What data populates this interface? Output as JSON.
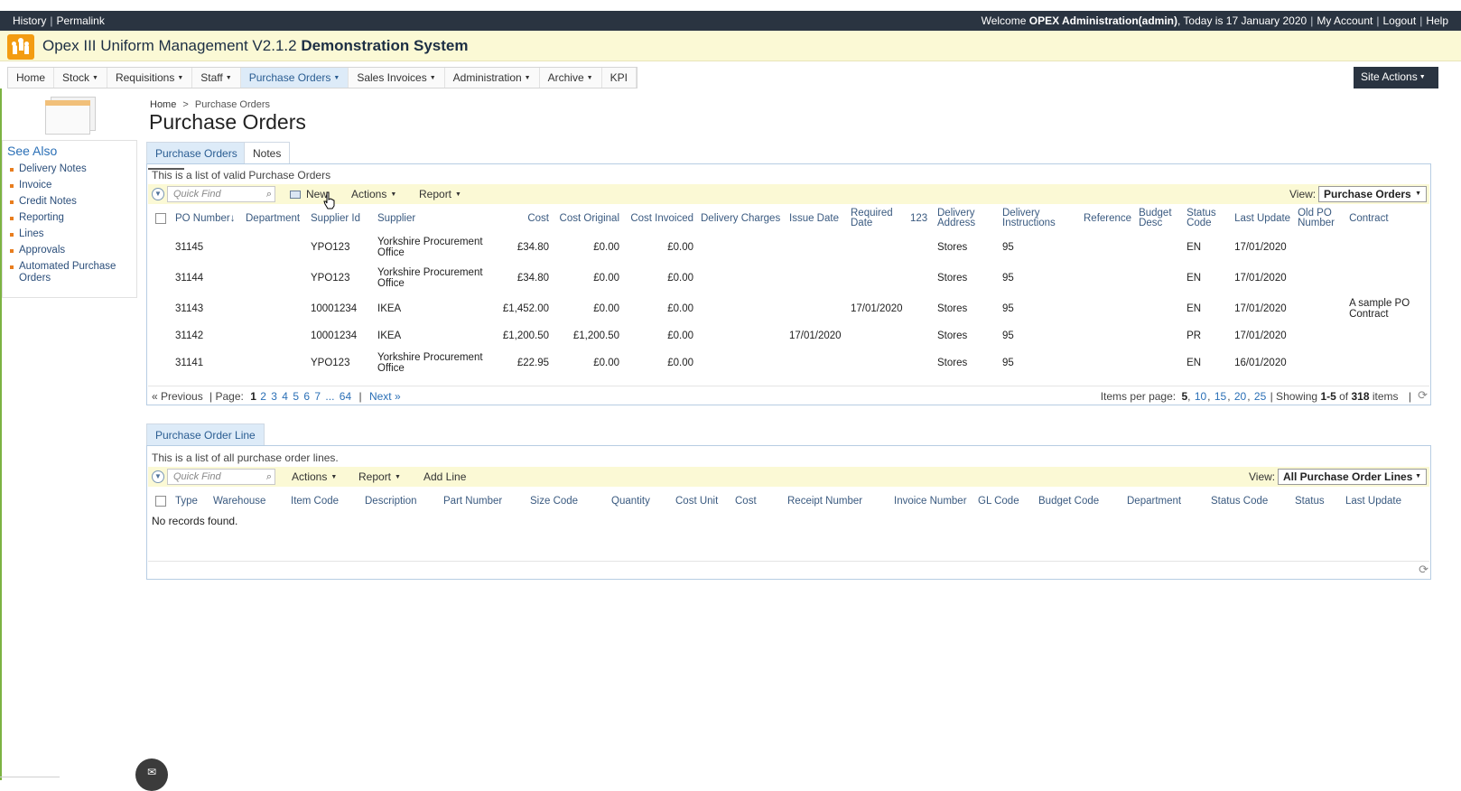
{
  "topbar": {
    "history": "History",
    "permalink": "Permalink",
    "welcome_prefix": "Welcome ",
    "user": "OPEX Administration(admin)",
    "today": ", Today is 17 January 2020",
    "my_account": "My Account",
    "logout": "Logout",
    "help": "Help"
  },
  "app": {
    "title_main": "Opex III Uniform Management V2.1.2 ",
    "title_bold": "Demonstration System",
    "accent": "#f39c12"
  },
  "nav": {
    "items": [
      {
        "label": "Home"
      },
      {
        "label": "Stock"
      },
      {
        "label": "Requisitions"
      },
      {
        "label": "Staff"
      },
      {
        "label": "Purchase Orders"
      },
      {
        "label": "Sales Invoices"
      },
      {
        "label": "Administration"
      },
      {
        "label": "Archive"
      },
      {
        "label": "KPI"
      }
    ],
    "site_actions": "Site Actions"
  },
  "sidebar": {
    "see_also": "See Also",
    "links": [
      "Delivery Notes",
      "Invoice",
      "Credit Notes",
      "Reporting",
      "Lines",
      "Approvals",
      "Automated Purchase Orders"
    ]
  },
  "breadcrumb": {
    "home": "Home",
    "sep": ">",
    "current": "Purchase Orders"
  },
  "page_title": "Purchase Orders",
  "tabs": {
    "purchase_orders": "Purchase Orders",
    "notes": "Notes",
    "purchase_order_line": "Purchase Order Line"
  },
  "po_panel": {
    "description": "This is a list of valid Purchase Orders",
    "quick_find": "Quick Find",
    "new": "New",
    "actions": "Actions",
    "report": "Report",
    "view_label": "View:",
    "view_value": "Purchase Orders",
    "columns": [
      "PO Number↓",
      "Department",
      "Supplier Id",
      "Supplier",
      "Cost",
      "Cost Original",
      "Cost Invoiced",
      "Delivery Charges",
      "Issue Date",
      "Required Date",
      "123",
      "Delivery Address",
      "Delivery Instructions",
      "Reference",
      "Budget Desc",
      "Status Code",
      "Last Update",
      "Old PO Number",
      "Contract"
    ],
    "rows": [
      {
        "po": "31145",
        "dept": "",
        "supplier_id": "YPO123",
        "supplier": "Yorkshire Procurement Office",
        "cost": "£34.80",
        "cost_original": "£0.00",
        "cost_invoiced": "£0.00",
        "delivery_charges": "",
        "issue_date": "",
        "required_date": "",
        "c123": "",
        "delivery_address": "Stores",
        "delivery_instructions": "95",
        "reference": "",
        "budget_desc": "",
        "status_code": "EN",
        "last_update": "17/01/2020",
        "old_po": "",
        "contract": ""
      },
      {
        "po": "31144",
        "dept": "",
        "supplier_id": "YPO123",
        "supplier": "Yorkshire Procurement Office",
        "cost": "£34.80",
        "cost_original": "£0.00",
        "cost_invoiced": "£0.00",
        "delivery_charges": "",
        "issue_date": "",
        "required_date": "",
        "c123": "",
        "delivery_address": "Stores",
        "delivery_instructions": "95",
        "reference": "",
        "budget_desc": "",
        "status_code": "EN",
        "last_update": "17/01/2020",
        "old_po": "",
        "contract": ""
      },
      {
        "po": "31143",
        "dept": "",
        "supplier_id": "10001234",
        "supplier": "IKEA",
        "cost": "£1,452.00",
        "cost_original": "£0.00",
        "cost_invoiced": "£0.00",
        "delivery_charges": "",
        "issue_date": "",
        "required_date": "17/01/2020",
        "c123": "",
        "delivery_address": "Stores",
        "delivery_instructions": "95",
        "reference": "",
        "budget_desc": "",
        "status_code": "EN",
        "last_update": "17/01/2020",
        "old_po": "",
        "contract": "A sample PO Contract"
      },
      {
        "po": "31142",
        "dept": "",
        "supplier_id": "10001234",
        "supplier": "IKEA",
        "cost": "£1,200.50",
        "cost_original": "£1,200.50",
        "cost_invoiced": "£0.00",
        "delivery_charges": "",
        "issue_date": "17/01/2020",
        "required_date": "",
        "c123": "",
        "delivery_address": "Stores",
        "delivery_instructions": "95",
        "reference": "",
        "budget_desc": "",
        "status_code": "PR",
        "last_update": "17/01/2020",
        "old_po": "",
        "contract": ""
      },
      {
        "po": "31141",
        "dept": "",
        "supplier_id": "YPO123",
        "supplier": "Yorkshire Procurement Office",
        "cost": "£22.95",
        "cost_original": "£0.00",
        "cost_invoiced": "£0.00",
        "delivery_charges": "",
        "issue_date": "",
        "required_date": "",
        "c123": "",
        "delivery_address": "Stores",
        "delivery_instructions": "95",
        "reference": "",
        "budget_desc": "",
        "status_code": "EN",
        "last_update": "16/01/2020",
        "old_po": "",
        "contract": ""
      }
    ],
    "pager": {
      "previous": "« Previous",
      "page_label": "| Page:",
      "pages": [
        "1",
        "2",
        "3",
        "4",
        "5",
        "6",
        "7",
        "...",
        "64"
      ],
      "next": "Next »",
      "items_per_page": "Items per page:",
      "ipp_current": "5",
      "ipp_options": [
        "10",
        "15",
        "20",
        "25"
      ],
      "showing": "| Showing",
      "range": "1-5",
      "of": "of",
      "total": "318",
      "items": "items"
    }
  },
  "pol_panel": {
    "description": "This is a list of all purchase order lines.",
    "quick_find": "Quick Find",
    "actions": "Actions",
    "report": "Report",
    "add_line": "Add Line",
    "view_label": "View:",
    "view_value": "All Purchase Order Lines",
    "columns": [
      "Type",
      "Warehouse",
      "Item Code",
      "Description",
      "Part Number",
      "Size Code",
      "Quantity",
      "Cost Unit",
      "Cost",
      "Receipt Number",
      "Invoice Number",
      "GL Code",
      "Budget Code",
      "Department",
      "Status Code",
      "Status",
      "Last Update"
    ],
    "empty": "No records found."
  }
}
